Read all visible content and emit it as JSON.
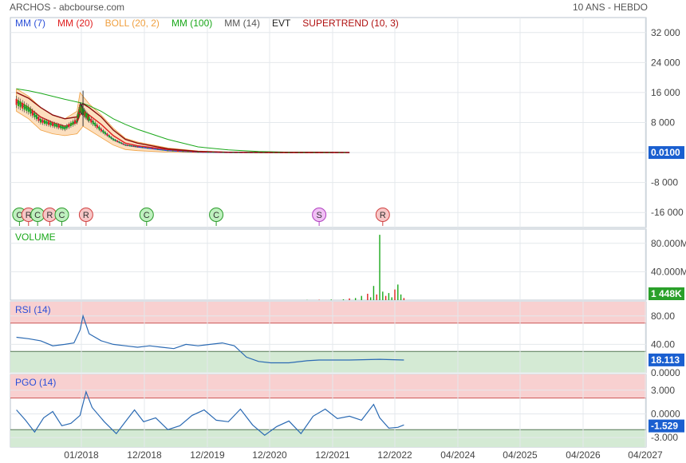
{
  "header": {
    "title": "ARCHOS - abcbourse.com",
    "period": "10 ANS - HEBDO"
  },
  "legend": [
    {
      "label": "MM (7)",
      "color": "#2b4fd8"
    },
    {
      "label": "MM (20)",
      "color": "#e02020"
    },
    {
      "label": "BOLL (20, 2)",
      "color": "#f0a040"
    },
    {
      "label": "MM (100)",
      "color": "#1aa81a"
    },
    {
      "label": "MM (14)",
      "color": "#555555"
    },
    {
      "label": "EVT",
      "color": "#222222"
    },
    {
      "label": "SUPERTREND (10, 3)",
      "color": "#b01010"
    }
  ],
  "colors": {
    "candle_up": "#1aa81a",
    "candle_down": "#e02020",
    "boll_fill": "#fbd9b4",
    "value_badge": "#1a5fd0",
    "volume_badge": "#2aa02a",
    "indicator_line": "#2b6ab3",
    "overbought_zone": "#f8d0d0",
    "oversold_zone": "#d4ead4",
    "grid": "#e4e8ec"
  },
  "x_axis": {
    "ticks": [
      "01/2018",
      "12/2018",
      "12/2019",
      "12/2020",
      "12/2021",
      "12/2022",
      "04/2024",
      "04/2025",
      "04/2026",
      "04/2027"
    ]
  },
  "chart_data": [
    {
      "type": "line",
      "panel": "price",
      "y_ticks": [
        "32 000",
        "24 000",
        "16 000",
        "8 000",
        "-8 000",
        "-16 000"
      ],
      "ylim": [
        -20000,
        36000
      ],
      "last_value": "0.0100",
      "x": [
        2017.0,
        2017.2,
        2017.4,
        2017.6,
        2017.8,
        2018.0,
        2018.05,
        2018.1,
        2018.2,
        2018.4,
        2018.6,
        2018.8,
        2019.0,
        2019.5,
        2020.0,
        2020.5,
        2021.0,
        2021.5,
        2022.0,
        2022.5
      ],
      "series": [
        {
          "name": "MM (7)",
          "values": [
            13500,
            11500,
            8500,
            7500,
            6500,
            8500,
            12000,
            11000,
            9000,
            6000,
            3500,
            2000,
            1500,
            500,
            100,
            20,
            10,
            5,
            5,
            1
          ]
        },
        {
          "name": "MM (20)",
          "values": [
            14000,
            12000,
            9500,
            8000,
            7000,
            8000,
            10000,
            11000,
            10000,
            7500,
            4500,
            2500,
            1800,
            800,
            200,
            50,
            20,
            10,
            5,
            1
          ]
        },
        {
          "name": "MM (100)",
          "values": [
            17000,
            16500,
            15800,
            15000,
            14200,
            13500,
            13300,
            13100,
            12500,
            11000,
            9000,
            7500,
            6200,
            3500,
            1500,
            700,
            300,
            100,
            50,
            20
          ]
        },
        {
          "name": "SUPERTREND (10, 3)",
          "values": [
            16000,
            14500,
            12000,
            10000,
            9000,
            9500,
            12500,
            13000,
            12000,
            9500,
            6000,
            3500,
            2500,
            1000,
            300,
            80,
            30,
            15,
            8,
            2
          ]
        }
      ],
      "bollinger_upper": [
        17000,
        15000,
        12000,
        10000,
        9000,
        11000,
        16000,
        15000,
        13000,
        10000,
        6500,
        3800,
        2800,
        1200,
        400,
        100,
        40,
        20,
        10,
        2
      ],
      "bollinger_lower": [
        11000,
        9000,
        6000,
        5000,
        4500,
        5000,
        6000,
        7000,
        6000,
        4000,
        2000,
        800,
        500,
        100,
        0,
        0,
        0,
        0,
        0,
        0
      ],
      "events": [
        {
          "label": "C",
          "x": 2017.05
        },
        {
          "label": "R",
          "x": 2017.2
        },
        {
          "label": "C",
          "x": 2017.35
        },
        {
          "label": "R",
          "x": 2017.55
        },
        {
          "label": "C",
          "x": 2017.75
        },
        {
          "label": "R",
          "x": 2018.15
        },
        {
          "label": "C",
          "x": 2019.15
        },
        {
          "label": "C",
          "x": 2020.3
        },
        {
          "label": "S",
          "x": 2022.0
        },
        {
          "label": "R",
          "x": 2023.05
        }
      ]
    },
    {
      "type": "bar",
      "panel": "volume",
      "title": "VOLUME",
      "y_ticks": [
        "80.000M",
        "40.000M"
      ],
      "ylim": [
        0,
        100000000
      ],
      "last_value": "1 448K",
      "x": [
        2021.8,
        2022.0,
        2022.2,
        2022.4,
        2022.5,
        2022.6,
        2022.7,
        2022.8,
        2022.85,
        2022.9,
        2022.95,
        2023.0,
        2023.05,
        2023.1,
        2023.15,
        2023.2,
        2023.25,
        2023.3,
        2023.35,
        2023.4
      ],
      "values": [
        300000,
        500000,
        800000,
        1200000,
        2500000,
        3000000,
        6000000,
        9000000,
        4000000,
        20000000,
        8000000,
        92000000,
        12000000,
        6000000,
        10000000,
        4000000,
        15000000,
        22000000,
        8000000,
        3000000
      ]
    },
    {
      "type": "line",
      "panel": "rsi",
      "title": "RSI (14)",
      "y_ticks": [
        "80.00",
        "40.00",
        "0.0000"
      ],
      "ylim": [
        0,
        100
      ],
      "overbought": 70,
      "oversold": 30,
      "last_value": "18.113",
      "x": [
        2017.0,
        2017.2,
        2017.4,
        2017.6,
        2017.8,
        2017.95,
        2018.05,
        2018.1,
        2018.2,
        2018.4,
        2018.6,
        2018.8,
        2019.0,
        2019.2,
        2019.4,
        2019.6,
        2019.8,
        2020.0,
        2020.2,
        2020.4,
        2020.6,
        2020.8,
        2021.0,
        2021.2,
        2021.5,
        2021.8,
        2022.0,
        2022.5,
        2023.0,
        2023.4
      ],
      "values": [
        50,
        48,
        45,
        38,
        40,
        42,
        60,
        80,
        55,
        45,
        40,
        38,
        36,
        38,
        36,
        34,
        40,
        38,
        40,
        42,
        38,
        22,
        16,
        14,
        14,
        17,
        18,
        18,
        19,
        18
      ]
    },
    {
      "type": "line",
      "panel": "pgo",
      "title": "PGO (14)",
      "y_ticks": [
        "3.000",
        "0.0000",
        "-3.000"
      ],
      "ylim": [
        -4.2,
        5
      ],
      "overbought": 2,
      "oversold": -2,
      "last_value": "-1.529",
      "x": [
        2017.0,
        2017.15,
        2017.3,
        2017.45,
        2017.6,
        2017.75,
        2017.9,
        2018.05,
        2018.15,
        2018.25,
        2018.45,
        2018.65,
        2018.8,
        2018.95,
        2019.1,
        2019.3,
        2019.5,
        2019.7,
        2019.9,
        2020.1,
        2020.3,
        2020.5,
        2020.7,
        2020.9,
        2021.1,
        2021.3,
        2021.5,
        2021.7,
        2021.9,
        2022.1,
        2022.3,
        2022.5,
        2022.7,
        2022.9,
        2023.0,
        2023.15,
        2023.3,
        2023.4
      ],
      "values": [
        0.5,
        -0.8,
        -2.3,
        -0.5,
        0.3,
        -1.5,
        -1.2,
        -0.2,
        2.8,
        0.8,
        -1.0,
        -2.5,
        -1.0,
        0.5,
        -1.0,
        -0.5,
        -2.0,
        -1.5,
        -0.2,
        0.5,
        -0.8,
        -1.0,
        0.6,
        -1.4,
        -2.7,
        -1.6,
        -0.9,
        -2.5,
        -0.3,
        0.6,
        -0.6,
        -0.3,
        -0.8,
        1.2,
        -0.5,
        -1.8,
        -1.7,
        -1.4
      ]
    }
  ]
}
